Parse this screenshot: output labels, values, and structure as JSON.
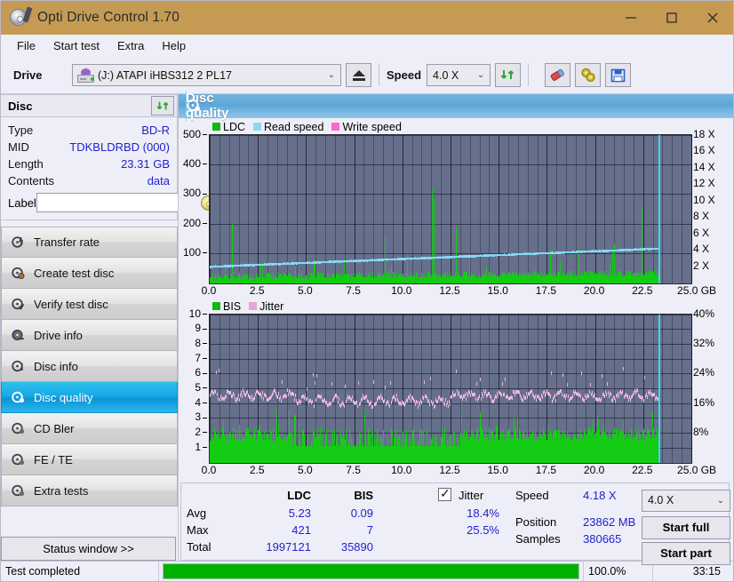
{
  "window": {
    "title": "Opti Drive Control 1.70",
    "app_icon": "disc-icon",
    "minimize": "minimize-icon",
    "maximize": "maximize-icon",
    "close": "close-icon"
  },
  "menu": {
    "items": [
      {
        "label": "File"
      },
      {
        "label": "Start test"
      },
      {
        "label": "Extra"
      },
      {
        "label": "Help"
      }
    ]
  },
  "toolbar": {
    "drive_label": "Drive",
    "drive_value": "(J:)  ATAPI iHBS312  2 PL17",
    "eject_tip": "eject-icon",
    "speed_label": "Speed",
    "speed_value": "4.0 X",
    "refresh_tip": "refresh-icon",
    "erase_tip": "erase-icon",
    "settings_tip": "settings-icon",
    "save_tip": "save-icon"
  },
  "disc": {
    "header": "Disc",
    "refresh_tip": "refresh-icon",
    "fields": [
      {
        "key": "Type",
        "value": "BD-R"
      },
      {
        "key": "MID",
        "value": "TDKBLDRBD (000)"
      },
      {
        "key": "Length",
        "value": "23.31 GB"
      },
      {
        "key": "Contents",
        "value": "data"
      }
    ],
    "label_key": "Label",
    "label_value": "",
    "label_placeholder": ""
  },
  "sidebar": {
    "items": [
      {
        "label": "Transfer rate",
        "icon": "disc-bolt-icon",
        "active": false
      },
      {
        "label": "Create test disc",
        "icon": "disc-write-icon",
        "active": false
      },
      {
        "label": "Verify test disc",
        "icon": "disc-check-icon",
        "active": false
      },
      {
        "label": "Drive info",
        "icon": "disc-info-icon",
        "active": false
      },
      {
        "label": "Disc info",
        "icon": "disc-detail-icon",
        "active": false
      },
      {
        "label": "Disc quality",
        "icon": "disc-quality-icon",
        "active": true
      },
      {
        "label": "CD Bler",
        "icon": "disc-bler-icon",
        "active": false
      },
      {
        "label": "FE / TE",
        "icon": "disc-fete-icon",
        "active": false
      },
      {
        "label": "Extra tests",
        "icon": "disc-extra-icon",
        "active": false
      }
    ],
    "status_window": "Status window >>"
  },
  "panel": {
    "title": "Disc quality",
    "icon": "disc-quality-icon"
  },
  "chart_data": [
    {
      "type": "line",
      "title": "Disc quality - LDC / Read speed",
      "legend": [
        {
          "label": "LDC",
          "color": "#12b812"
        },
        {
          "label": "Read speed",
          "color": "#8ad8f5"
        },
        {
          "label": "Write speed",
          "color": "#ff66cc"
        }
      ],
      "legend_position": "top-left",
      "xlabel": "GB",
      "xlim": [
        0.0,
        25.0
      ],
      "xticks": [
        "0.0",
        "2.5",
        "5.0",
        "7.5",
        "10.0",
        "12.5",
        "15.0",
        "17.5",
        "20.0",
        "22.5",
        "25.0"
      ],
      "ylabel": "LDC",
      "ylim": [
        0,
        500
      ],
      "yticks": [
        100,
        200,
        300,
        400,
        500
      ],
      "y2label": "Speed",
      "y2lim": [
        0,
        18
      ],
      "y2ticks": [
        "2 X",
        "4 X",
        "6 X",
        "8 X",
        "10 X",
        "12 X",
        "14 X",
        "16 X",
        "18 X"
      ],
      "grid": true,
      "data_end_gb": 23.31,
      "series": [
        {
          "name": "LDC",
          "color": "#12b812",
          "style": "bars",
          "note": "dense green baseline ~20-40 with sparse spikes; max 421"
        },
        {
          "name": "Read speed",
          "color": "#8ad8f5",
          "style": "line",
          "note": "rises smoothly from ~2.0 X to ~4.2 X across the disc"
        }
      ]
    },
    {
      "type": "line",
      "title": "Disc quality - BIS / Jitter",
      "legend": [
        {
          "label": "BIS",
          "color": "#12b812"
        },
        {
          "label": "Jitter",
          "color": "#e0a8d8"
        }
      ],
      "legend_position": "top-left",
      "xlabel": "GB",
      "xlim": [
        0.0,
        25.0
      ],
      "xticks": [
        "0.0",
        "2.5",
        "5.0",
        "7.5",
        "10.0",
        "12.5",
        "15.0",
        "17.5",
        "20.0",
        "22.5",
        "25.0"
      ],
      "ylabel": "BIS",
      "ylim": [
        0,
        10
      ],
      "yticks": [
        1,
        2,
        3,
        4,
        5,
        6,
        7,
        8,
        9,
        10
      ],
      "y2label": "Jitter",
      "y2lim": [
        0,
        40
      ],
      "y2ticks": [
        "8%",
        "16%",
        "24%",
        "32%",
        "40%"
      ],
      "grid": true,
      "data_end_gb": 23.31,
      "series": [
        {
          "name": "BIS",
          "color": "#12b812",
          "style": "bars",
          "note": "filled band up to ~2-3 with spikes to 7"
        },
        {
          "name": "Jitter",
          "color": "#e0a8d8",
          "style": "line",
          "note": "oscillates ~4.3-5.2 (17-21%) with peaks near 6 (24%)"
        }
      ]
    }
  ],
  "stats": {
    "columns": [
      "LDC",
      "BIS"
    ],
    "rows": [
      {
        "label": "Avg",
        "ldc": "5.23",
        "bis": "0.09",
        "jitter": "18.4%"
      },
      {
        "label": "Max",
        "ldc": "421",
        "bis": "7",
        "jitter": "25.5%"
      },
      {
        "label": "Total",
        "ldc": "1997121",
        "bis": "35890",
        "jitter": ""
      }
    ],
    "jitter_label": "Jitter",
    "jitter_checked": true,
    "speed_label": "Speed",
    "speed_value": "4.18 X",
    "position_label": "Position",
    "position_value": "23862 MB",
    "samples_label": "Samples",
    "samples_value": "380665",
    "speed_select": "4.0 X",
    "start_full": "Start full",
    "start_part": "Start part"
  },
  "statusbar": {
    "message": "Test completed",
    "progress_pct": 100.0,
    "progress_text": "100.0%",
    "elapsed": "33:15"
  },
  "colors": {
    "titlebar": "#c59b54",
    "accent": "#2222cc",
    "plot_bg": "#66708c",
    "ldc_green": "#12b812",
    "read_speed": "#8ad8f5",
    "jitter_pink": "#e0a8d8",
    "progress_green": "#00b200",
    "active_nav": "#16a9e4"
  }
}
